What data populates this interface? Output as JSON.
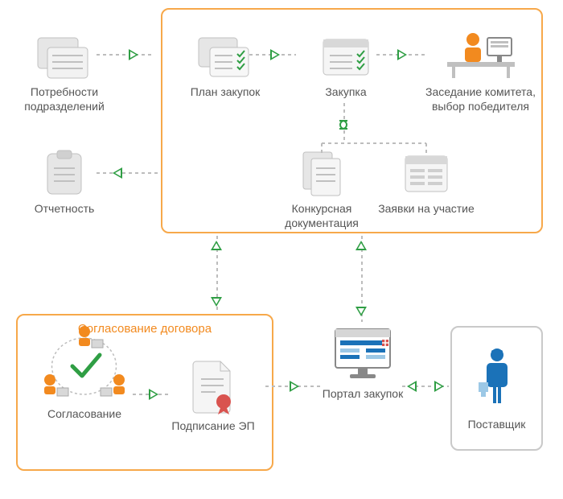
{
  "nodes": {
    "needs": "Потребности подразделений",
    "reporting": "Отчетность",
    "plan": "План закупок",
    "purchase": "Закупка",
    "committee": "Заседание комитета, выбор победителя",
    "tender_docs": "Конкурсная документация",
    "bids": "Заявки на участие",
    "portal": "Портал закупок",
    "supplier": "Поставщик",
    "approval_group": "Согласование договора",
    "approval": "Согласование",
    "signing": "Подписание ЭП"
  },
  "colors": {
    "orange": "#f28a1f",
    "green": "#2f9e44",
    "blue": "#1b72b8",
    "grey": "#c9c9c9"
  }
}
